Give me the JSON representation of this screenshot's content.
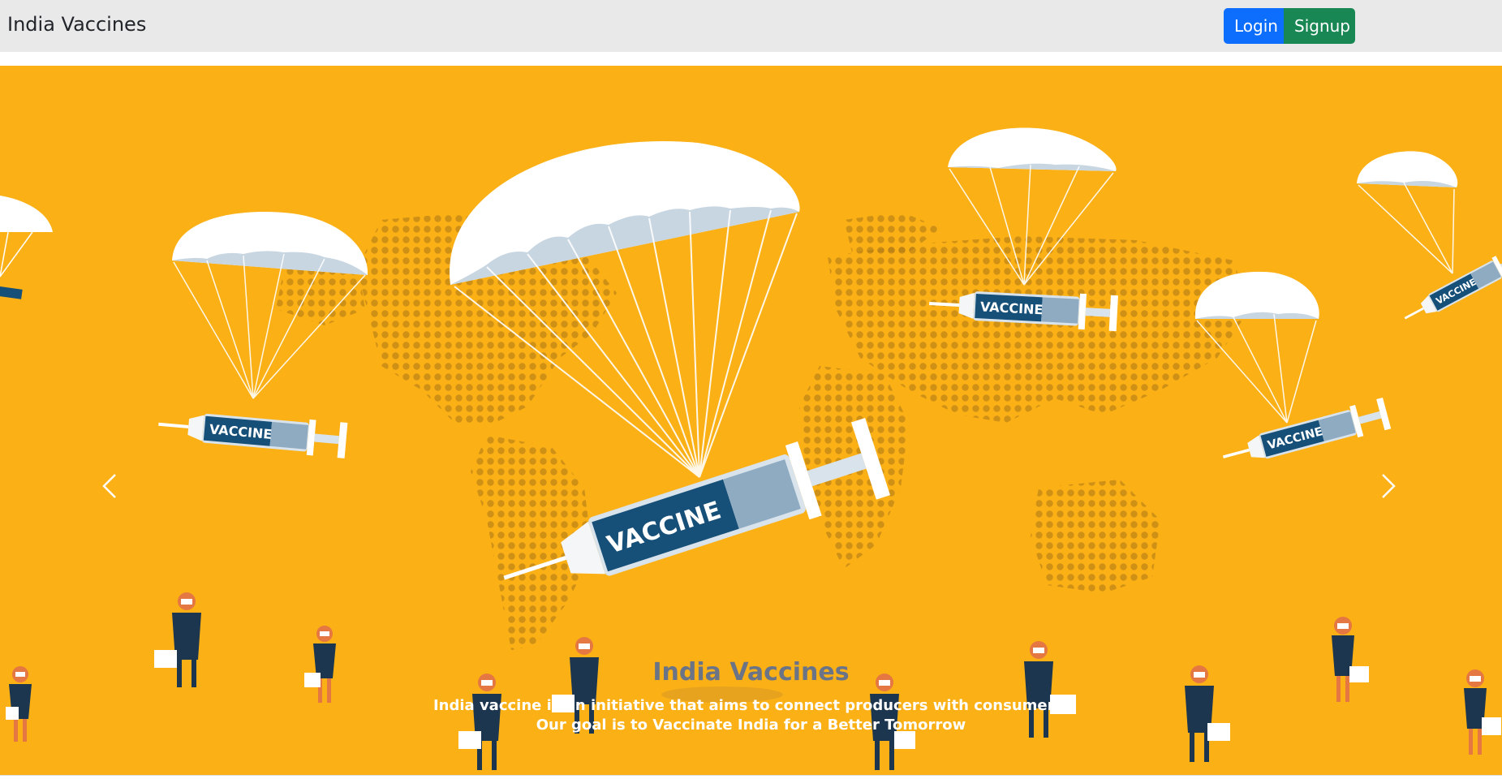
{
  "navbar": {
    "brand": "India Vaccines",
    "login_label": "Login",
    "signup_label": "Signup"
  },
  "carousel": {
    "caption_title": "India Vaccines",
    "caption_line1": "India vaccine is an initiative that aims to connect producers with consumers.",
    "caption_line2": "Our goal is to Vaccinate India for a Better Tomorrow",
    "syringe_label": "VACCINE",
    "prev_icon": "chevron-left-icon",
    "next_icon": "chevron-right-icon"
  },
  "colors": {
    "navbar_bg": "#e9e9e9",
    "login_button": "#0d6efd",
    "signup_button": "#198754",
    "banner_bg": "#fbb016",
    "syringe_blue": "#1a4f7a"
  }
}
